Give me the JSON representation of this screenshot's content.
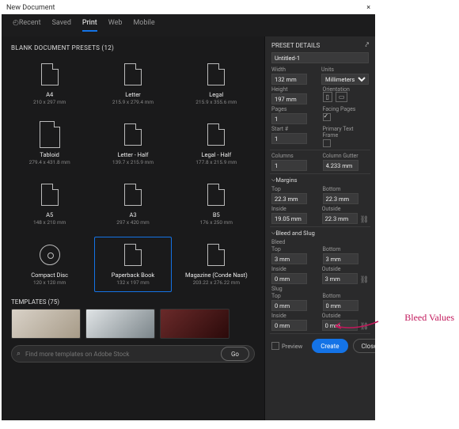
{
  "titlebar": {
    "title": "New Document",
    "close": "×"
  },
  "tabs": {
    "recent": "Recent",
    "saved": "Saved",
    "print": "Print",
    "web": "Web",
    "mobile": "Mobile",
    "active": "print"
  },
  "left_head": "BLANK DOCUMENT PRESETS  (12)",
  "presets": [
    {
      "name": "A4",
      "dim": "210 x 297 mm",
      "shape": "page"
    },
    {
      "name": "Letter",
      "dim": "215.9 x 279.4 mm",
      "shape": "page"
    },
    {
      "name": "Legal",
      "dim": "215.9 x 355.6 mm",
      "shape": "page"
    },
    {
      "name": "Tabloid",
      "dim": "279.4 x 431.8 mm",
      "shape": "wide"
    },
    {
      "name": "Letter - Half",
      "dim": "139.7 x 215.9 mm",
      "shape": "page"
    },
    {
      "name": "Legal - Half",
      "dim": "177.8 x 215.9 mm",
      "shape": "page"
    },
    {
      "name": "A5",
      "dim": "148 x 210 mm",
      "shape": "page"
    },
    {
      "name": "A3",
      "dim": "297 x 420 mm",
      "shape": "page"
    },
    {
      "name": "B5",
      "dim": "176 x 250 mm",
      "shape": "page"
    },
    {
      "name": "Compact Disc",
      "dim": "120 x 120 mm",
      "shape": "cd"
    },
    {
      "name": "Paperback Book",
      "dim": "132 x 197 mm",
      "shape": "page",
      "selected": true
    },
    {
      "name": "Magazine (Conde Nast)",
      "dim": "203.22 x 276.22 mm",
      "shape": "page"
    }
  ],
  "templates_head": "TEMPLATES  (75)",
  "search": {
    "placeholder": "Find more templates on Adobe Stock",
    "go": "Go"
  },
  "right_panel": {
    "head": "PRESET DETAILS",
    "docname": "Untitled-1",
    "width": {
      "label": "Width",
      "value": "132 mm"
    },
    "units": {
      "label": "Units",
      "value": "Millimeters"
    },
    "height": {
      "label": "Height",
      "value": "197 mm"
    },
    "orientation_label": "Orientation",
    "pages": {
      "label": "Pages",
      "value": "1"
    },
    "facing": {
      "label": "Facing Pages",
      "checked": true
    },
    "start": {
      "label": "Start #",
      "value": "1"
    },
    "ptf": {
      "label": "Primary Text Frame",
      "checked": false
    },
    "columns": {
      "label": "Columns",
      "value": "1"
    },
    "gutter": {
      "label": "Column Gutter",
      "value": "4.233 mm"
    },
    "margins_head": "Margins",
    "margins": {
      "top": {
        "label": "Top",
        "value": "22.3 mm"
      },
      "bottom": {
        "label": "Bottom",
        "value": "22.3 mm"
      },
      "inside": {
        "label": "Inside",
        "value": "19.05 mm"
      },
      "outside": {
        "label": "Outside",
        "value": "22.3 mm"
      }
    },
    "bleedslug_head": "Bleed and Slug",
    "bleed_label": "Bleed",
    "bleed": {
      "top": {
        "label": "Top",
        "value": "3 mm"
      },
      "bottom": {
        "label": "Bottom",
        "value": "3 mm"
      },
      "inside": {
        "label": "Inside",
        "value": "0 mm"
      },
      "outside": {
        "label": "Outside",
        "value": "3 mm"
      }
    },
    "slug_label": "Slug",
    "slug": {
      "top": {
        "label": "Top",
        "value": "0 mm"
      },
      "bottom": {
        "label": "Bottom",
        "value": "0 mm"
      },
      "inside": {
        "label": "Inside",
        "value": "0 mm"
      },
      "outside": {
        "label": "Outside",
        "value": "0 mm"
      }
    },
    "preview": "Preview",
    "create": "Create",
    "close": "Close"
  },
  "annotation": "Bleed Values"
}
